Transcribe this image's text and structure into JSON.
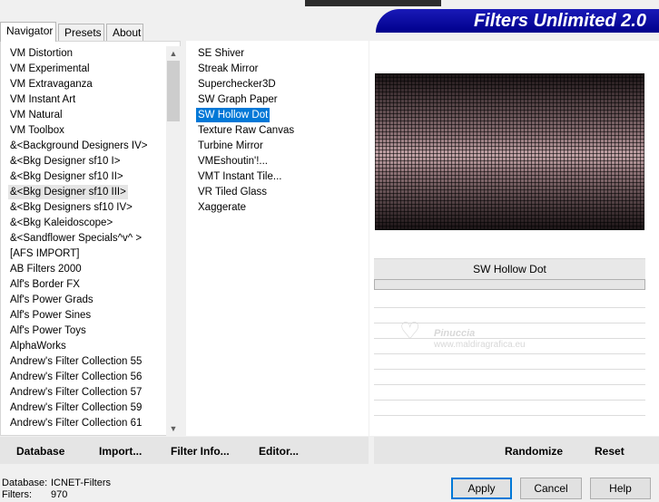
{
  "app": {
    "title": "Filters Unlimited 2.0"
  },
  "tabs": [
    {
      "label": "Navigator",
      "active": true
    },
    {
      "label": "Presets",
      "active": false
    },
    {
      "label": "About",
      "active": false
    }
  ],
  "categories": {
    "selected": "&<Bkg Designer sf10 III>",
    "items": [
      "VM Distortion",
      "VM Experimental",
      "VM Extravaganza",
      "VM Instant Art",
      "VM Natural",
      "VM Toolbox",
      "&<Background Designers IV>",
      "&<Bkg Designer sf10 I>",
      "&<Bkg Designer sf10 II>",
      "&<Bkg Designer sf10 III>",
      "&<Bkg Designers sf10 IV>",
      "&<Bkg Kaleidoscope>",
      "&<Sandflower Specials^v^ >",
      "[AFS IMPORT]",
      "AB Filters 2000",
      "Alf's Border FX",
      "Alf's Power Grads",
      "Alf's Power Sines",
      "Alf's Power Toys",
      "AlphaWorks",
      "Andrew's Filter Collection 55",
      "Andrew's Filter Collection 56",
      "Andrew's Filter Collection 57",
      "Andrew's Filter Collection 59",
      "Andrew's Filter Collection 61"
    ],
    "scroll_up_icon": "triangle-up",
    "scroll_down_icon": "triangle-down"
  },
  "filters": {
    "selected": "SW Hollow Dot",
    "items": [
      "SE Shiver",
      "Streak Mirror",
      "Superchecker3D",
      "SW Graph Paper",
      "SW Hollow Dot",
      "Texture Raw Canvas",
      "Turbine Mirror",
      "VMEshoutin'!...",
      "VMT Instant Tile...",
      "VR Tiled Glass",
      "Xaggerate"
    ]
  },
  "preview": {
    "filter_name": "SW Hollow Dot"
  },
  "watermark": {
    "name": "Pinuccia",
    "url": "www.maldiragrafica.eu"
  },
  "left_buttons": {
    "database": "Database",
    "import": "Import...",
    "filter_info": "Filter Info...",
    "editor": "Editor..."
  },
  "right_buttons": {
    "randomize": "Randomize",
    "reset": "Reset"
  },
  "status": {
    "database_label": "Database:",
    "database_value": "ICNET-Filters",
    "filters_label": "Filters:",
    "filters_value": "970"
  },
  "dialog_buttons": {
    "apply": "Apply",
    "cancel": "Cancel",
    "help": "Help"
  },
  "colors": {
    "selection_blue": "#0078d7",
    "banner_blue": "#00008b"
  }
}
